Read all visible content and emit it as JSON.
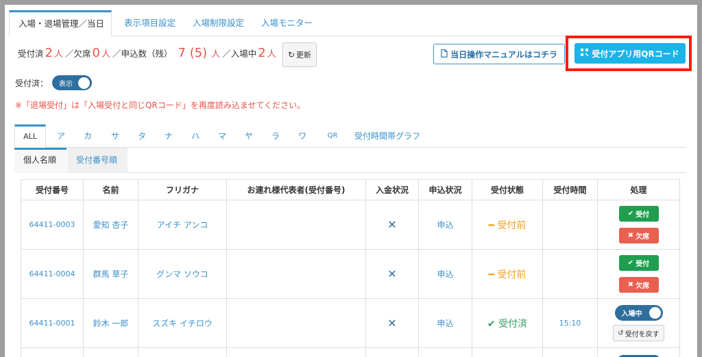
{
  "top_tabs": [
    {
      "label": "入場・退場管理／当日"
    },
    {
      "label": "表示項目設定"
    },
    {
      "label": "入場制限設定"
    },
    {
      "label": "入場モニター"
    }
  ],
  "stats": {
    "accepted_label": "受付済",
    "accepted_count": "2",
    "unit": "人",
    "sep1": "／",
    "absent_label": "欠席",
    "absent_count": "0",
    "applied_label": "申込数（残）",
    "applied_count": "7 (5)",
    "inside_label": "入場中",
    "inside_count": "2"
  },
  "buttons": {
    "refresh": "更新",
    "manual": "当日操作マニュアルはコチラ",
    "qr": "受付アプリ用QRコード"
  },
  "accepted_filter": {
    "label": "受付済：",
    "toggle": "表示"
  },
  "notice": "※「退場受付」は「入場受付と同じQRコード」を再度読み込ませてください。",
  "letter_tabs": [
    "ALL",
    "ア",
    "カ",
    "サ",
    "タ",
    "ナ",
    "ハ",
    "マ",
    "ヤ",
    "ラ",
    "ワ",
    "QR",
    "受付時間帯グラフ"
  ],
  "sort_tabs": [
    "個人名順",
    "受付番号順"
  ],
  "table": {
    "headers": [
      "受付番号",
      "名前",
      "フリガナ",
      "お連れ様代表者(受付番号)",
      "入金状況",
      "申込状況",
      "受付状態",
      "受付時間",
      "処理"
    ],
    "rows": [
      {
        "id": "64411-0003",
        "name": "愛知 杏子",
        "kana": "アイチ アンコ",
        "companion": "",
        "payment": "✕",
        "apply": "申込",
        "status": "受付前",
        "time": ""
      },
      {
        "id": "64411-0004",
        "name": "群馬 草子",
        "kana": "グンマ ソウコ",
        "companion": "",
        "payment": "✕",
        "apply": "申込",
        "status": "受付前",
        "time": ""
      },
      {
        "id": "64411-0001",
        "name": "鈴木 一郎",
        "kana": "スズキ イチロウ",
        "companion": "",
        "payment": "✕",
        "apply": "申込",
        "status": "受付済",
        "time": "15:10"
      }
    ],
    "action_accept": "受付",
    "action_absent": "欠席",
    "action_inside": "入場中",
    "action_undo": "受付を戻す"
  },
  "colors": {
    "accent": "#3a8fc9",
    "highlight": "#ff1a00",
    "qr_button": "#1ab4e8",
    "accept_green": "#1f9e4f",
    "absent_red": "#e8604f",
    "status_before": "#f0a020",
    "status_done": "#2e9e5e"
  }
}
